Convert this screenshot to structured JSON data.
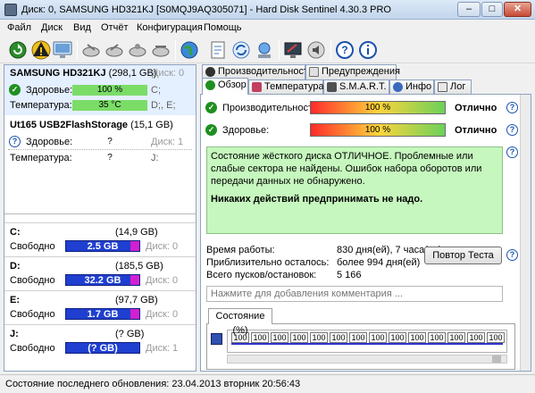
{
  "window": {
    "title": "Диск: 0, SAMSUNG HD321KJ [S0MQJ9AQ305071]  -  Hard Disk Sentinel 4.30.3 PRO",
    "minimize": "–",
    "maximize": "□",
    "close": "✕"
  },
  "menu": [
    "Файл",
    "Диск",
    "Вид",
    "Отчёт",
    "Конфигурация",
    "Помощь"
  ],
  "disks": [
    {
      "name": "SAMSUNG HD321KJ",
      "size": "(298,1 GB)",
      "index": "Диск: 0",
      "health_label": "Здоровье:",
      "health": "100 %",
      "health_suffix": "C;",
      "temp_label": "Температура:",
      "temp": "35 °C",
      "temp_suffix": "D;, E;"
    },
    {
      "name": "Ut165   USB2FlashStorage",
      "size": "(15,1 GB)",
      "index": "Диск: 1",
      "health_label": "Здоровье:",
      "health": "?",
      "health_suffix": "",
      "temp_label": "Температура:",
      "temp": "?",
      "temp_suffix": "J:"
    }
  ],
  "volumes": [
    {
      "letter": "C:",
      "size": "(14,9 GB)",
      "free_label": "Свободно",
      "free": "2.5 GB",
      "disk": "Диск: 0"
    },
    {
      "letter": "D:",
      "size": "(185,5 GB)",
      "free_label": "Свободно",
      "free": "32.2 GB",
      "disk": "Диск: 0"
    },
    {
      "letter": "E:",
      "size": "(97,7 GB)",
      "free_label": "Свободно",
      "free": "1.7 GB",
      "disk": "Диск: 0"
    },
    {
      "letter": "J:",
      "size": "(? GB)",
      "free_label": "Свободно",
      "free": "(? GB)",
      "disk": "Диск: 1"
    }
  ],
  "tabs_top": [
    "Производительность",
    "Предупреждения"
  ],
  "tabs_bottom": [
    "Обзор",
    "Температура",
    "S.M.A.R.T.",
    "Инфо",
    "Лог"
  ],
  "overview": {
    "performance_label": "Производительность:",
    "performance": "100 %",
    "performance_result": "Отлично",
    "health_label": "Здоровье:",
    "health": "100 %",
    "health_result": "Отлично",
    "message": "Состояние жёсткого диска ОТЛИЧНОЕ. Проблемные или слабые сектора не найдены. Ошибок набора оборотов или передачи данных не обнаружено.",
    "message_action": "Никаких действий предпринимать не надо.",
    "uptime_label": "Время работы:",
    "uptime": "830 дня(ей), 7 часа(ов)",
    "remaining_label": "Приблизительно осталось:",
    "remaining": "более 994 дня(ей)",
    "starts_label": "Всего пусков/остановок:",
    "starts": "5 166",
    "retest_button": "Повтор Теста",
    "comment_placeholder": "Нажмите для добавления комментария ...",
    "status_tab": "Состояние (%)"
  },
  "chart_data": {
    "type": "line",
    "series": [
      {
        "values": [
          100,
          100,
          100,
          100,
          100,
          100,
          100,
          100,
          100,
          100,
          100,
          100,
          100,
          100
        ]
      }
    ],
    "ylim": [
      0,
      100
    ]
  },
  "statusbar": "Состояние последнего обновления: 23.04.2013 вторник 20:56:43"
}
